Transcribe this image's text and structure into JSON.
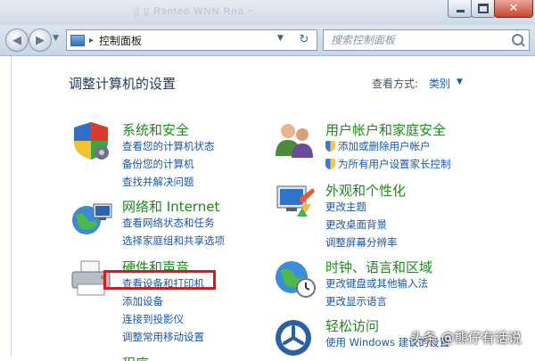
{
  "titlebar": {
    "ghost_text": "▯  ▯ Rsoteo  WNN  Rna ~"
  },
  "nav": {
    "breadcrumb_sep": "▸",
    "address": "控制面板",
    "search_placeholder": "搜索控制面板"
  },
  "header": {
    "title": "调整计算机的设置",
    "view_by_label": "查看方式:",
    "view_by_value": "类别"
  },
  "categories": {
    "system": {
      "title": "系统和安全",
      "links": [
        "查看您的计算机状态",
        "备份您的计算机",
        "查找并解决问题"
      ]
    },
    "network": {
      "title": "网络和 Internet",
      "links": [
        "查看网络状态和任务",
        "选择家庭组和共享选项"
      ]
    },
    "hardware": {
      "title": "硬件和声音",
      "links": [
        "查看设备和打印机",
        "添加设备",
        "连接到投影仪",
        "调整常用移动设置"
      ]
    },
    "users": {
      "title": "用户帐户和家庭安全",
      "links": [
        "添加或删除用户帐户",
        "为所有用户设置家长控制"
      ]
    },
    "appearance": {
      "title": "外观和个性化",
      "links": [
        "更改主题",
        "更改桌面背景",
        "调整屏幕分辨率"
      ]
    },
    "clock": {
      "title": "时钟、语言和区域",
      "links": [
        "更改键盘或其他输入法",
        "更改显示语言"
      ]
    },
    "access": {
      "title": "轻松访问",
      "links": [
        "使用 Windows 建议的设置"
      ]
    },
    "programs": {
      "title": "程序"
    }
  },
  "watermark": "头条 @熊仔有话说",
  "colors": {
    "category_title": "#1d8a1d",
    "link": "#1a57a8",
    "highlight_box": "#d7181f"
  }
}
